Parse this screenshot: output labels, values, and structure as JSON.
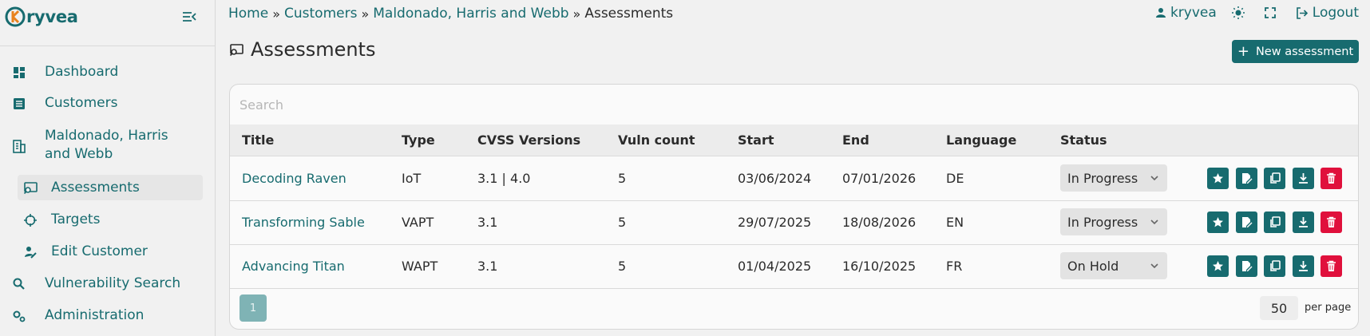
{
  "app": {
    "name": "ryvea",
    "brand_color": "#176b6f"
  },
  "sidebar": {
    "items": [
      {
        "label": "Dashboard",
        "icon": "dashboard-icon"
      },
      {
        "label": "Customers",
        "icon": "list-icon"
      },
      {
        "label": "Maldonado, Harris and Webb",
        "icon": "building-icon"
      },
      {
        "label": "Assessments",
        "icon": "assessment-icon",
        "active": true
      },
      {
        "label": "Targets",
        "icon": "crosshair-icon"
      },
      {
        "label": "Edit Customer",
        "icon": "user-edit-icon"
      },
      {
        "label": "Vulnerability Search",
        "icon": "search-icon"
      },
      {
        "label": "Administration",
        "icon": "gears-icon"
      }
    ]
  },
  "breadcrumb": {
    "items": [
      "Home",
      "Customers",
      "Maldonado, Harris and Webb"
    ],
    "separator": "»",
    "current": "Assessments"
  },
  "topbar": {
    "user": "kryvea",
    "logout": "Logout"
  },
  "page": {
    "title": "Assessments",
    "new_button": "New assessment"
  },
  "search": {
    "placeholder": "Search"
  },
  "table": {
    "columns": [
      "Title",
      "Type",
      "CVSS Versions",
      "Vuln count",
      "Start",
      "End",
      "Language",
      "Status"
    ],
    "rows": [
      {
        "title": "Decoding Raven",
        "type": "IoT",
        "cvss": "3.1 | 4.0",
        "vulns": "5",
        "start": "03/06/2024",
        "end": "07/01/2026",
        "language": "DE",
        "status": "In Progress"
      },
      {
        "title": "Transforming Sable",
        "type": "VAPT",
        "cvss": "3.1",
        "vulns": "5",
        "start": "29/07/2025",
        "end": "18/08/2026",
        "language": "EN",
        "status": "In Progress"
      },
      {
        "title": "Advancing Titan",
        "type": "WAPT",
        "cvss": "3.1",
        "vulns": "5",
        "start": "01/04/2025",
        "end": "16/10/2025",
        "language": "FR",
        "status": "On Hold"
      }
    ],
    "row_actions": [
      "star-icon",
      "edit-icon",
      "clone-icon",
      "download-icon",
      "delete-icon"
    ]
  },
  "pagination": {
    "current_page": "1",
    "per_page_value": "50",
    "per_page_label": "per page"
  },
  "colors": {
    "accent": "#176b6f",
    "danger": "#e0103c",
    "page_btn": "#7fb3b5"
  }
}
